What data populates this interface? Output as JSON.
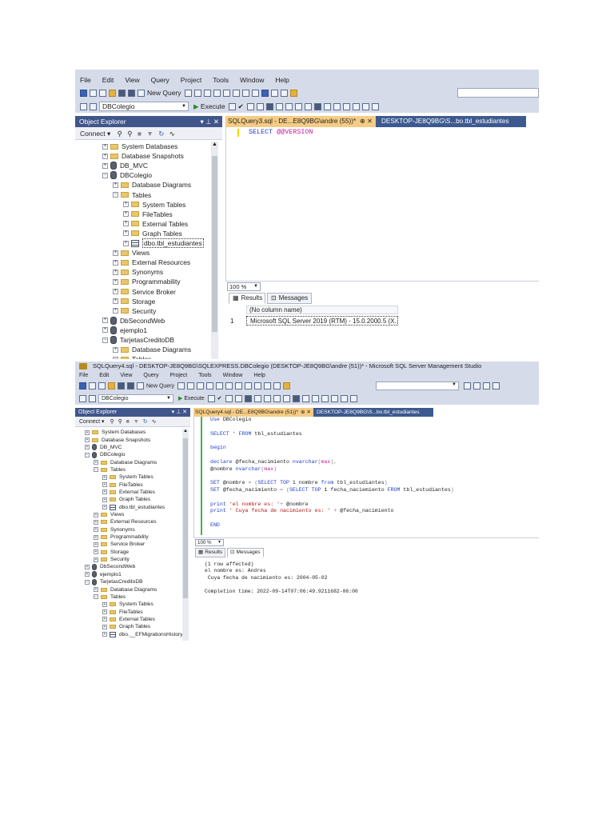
{
  "top": {
    "menu": [
      "File",
      "Edit",
      "View",
      "Query",
      "Project",
      "Tools",
      "Window",
      "Help"
    ],
    "new_query": "New Query",
    "db_selector": "DBColegio",
    "execute": "Execute",
    "explorer_title": "Object Explorer",
    "explorer_controls": "▾ ⊥ ✕",
    "connect": "Connect ▾",
    "tree": [
      {
        "label": "System Databases",
        "icon": "folder"
      },
      {
        "label": "Database Snapshots",
        "icon": "folder"
      },
      {
        "label": "DB_MVC",
        "icon": "database"
      },
      {
        "label": "DBColegio",
        "icon": "database"
      },
      {
        "label": "Database Diagrams",
        "icon": "folder"
      },
      {
        "label": "Tables",
        "icon": "folder"
      },
      {
        "label": "System Tables",
        "icon": "folder"
      },
      {
        "label": "FileTables",
        "icon": "folder"
      },
      {
        "label": "External Tables",
        "icon": "folder"
      },
      {
        "label": "Graph Tables",
        "icon": "folder"
      },
      {
        "label": "dbo.tbl_estudiantes",
        "icon": "table"
      },
      {
        "label": "Views",
        "icon": "folder"
      },
      {
        "label": "External Resources",
        "icon": "folder"
      },
      {
        "label": "Synonyms",
        "icon": "folder"
      },
      {
        "label": "Programmability",
        "icon": "folder"
      },
      {
        "label": "Service Broker",
        "icon": "folder"
      },
      {
        "label": "Storage",
        "icon": "folder"
      },
      {
        "label": "Security",
        "icon": "folder"
      },
      {
        "label": "DbSecondWeb",
        "icon": "database"
      },
      {
        "label": "ejemplo1",
        "icon": "database"
      },
      {
        "label": "TarjetasCreditoDB",
        "icon": "database"
      },
      {
        "label": "Database Diagrams",
        "icon": "folder"
      },
      {
        "label": "Tables",
        "icon": "folder"
      }
    ],
    "tab_active": "SQLQuery3.sql - DE...E8Q9BG\\andre (55))*",
    "tab_active_ctl": "⊕  ✕",
    "tab_other": "DESKTOP-JE8Q9BG\\S...bo.tbl_estudiantes",
    "code": {
      "kw": "SELECT",
      "fn": "@@VERSION"
    },
    "zoom": "100 %",
    "results_tab": "Results",
    "messages_tab": "Messages",
    "grid_header": "(No column name)",
    "grid_row_num": "1",
    "grid_value": "Microsoft SQL Server 2019 (RTM) - 15.0.2000.5 (X..."
  },
  "bottom": {
    "title": "SQLQuery4.sql - DESKTOP-JE8Q9BG\\SQLEXPRESS.DBColegio (DESKTOP-JE8Q9BG\\andre (51))* - Microsoft SQL Server Management Studio",
    "menu": [
      "File",
      "Edit",
      "View",
      "Query",
      "Project",
      "Tools",
      "Window",
      "Help"
    ],
    "new_query": "New Query",
    "db_selector": "DBColegio",
    "execute": "Execute",
    "explorer_title": "Object Explorer",
    "explorer_controls": "▾ ⊥ ✕",
    "connect": "Connect ▾",
    "tree": [
      {
        "label": "System Databases",
        "icon": "folder"
      },
      {
        "label": "Database Snapshots",
        "icon": "folder"
      },
      {
        "label": "DB_MVC",
        "icon": "database"
      },
      {
        "label": "DBColegio",
        "icon": "database"
      },
      {
        "label": "Database Diagrams",
        "icon": "folder"
      },
      {
        "label": "Tables",
        "icon": "folder"
      },
      {
        "label": "System Tables",
        "icon": "folder"
      },
      {
        "label": "FileTables",
        "icon": "folder"
      },
      {
        "label": "External Tables",
        "icon": "folder"
      },
      {
        "label": "Graph Tables",
        "icon": "folder"
      },
      {
        "label": "dbo.tbl_estudiantes",
        "icon": "table"
      },
      {
        "label": "Views",
        "icon": "folder"
      },
      {
        "label": "External Resources",
        "icon": "folder"
      },
      {
        "label": "Synonyms",
        "icon": "folder"
      },
      {
        "label": "Programmability",
        "icon": "folder"
      },
      {
        "label": "Service Broker",
        "icon": "folder"
      },
      {
        "label": "Storage",
        "icon": "folder"
      },
      {
        "label": "Security",
        "icon": "folder"
      },
      {
        "label": "DbSecondWeb",
        "icon": "database"
      },
      {
        "label": "ejemplo1",
        "icon": "database"
      },
      {
        "label": "TarjetasCreditoDB",
        "icon": "database"
      },
      {
        "label": "Database Diagrams",
        "icon": "folder"
      },
      {
        "label": "Tables",
        "icon": "folder"
      },
      {
        "label": "System Tables",
        "icon": "folder"
      },
      {
        "label": "FileTables",
        "icon": "folder"
      },
      {
        "label": "External Tables",
        "icon": "folder"
      },
      {
        "label": "Graph Tables",
        "icon": "folder"
      },
      {
        "label": "dbo.__EFMigrationsHistory",
        "icon": "table"
      }
    ],
    "tab_active": "SQLQuery4.sql - DE...E8Q9BG\\andre (51))*",
    "tab_active_ctl": "⊕  ✕",
    "tab_other": "DESKTOP-JE8Q9BG\\S...bo.tbl_estudiantes",
    "code_lines": [
      {
        "segs": [
          {
            "t": "Use",
            "c": "kw"
          },
          {
            "t": " DBColegio",
            "c": ""
          }
        ]
      },
      {
        "segs": []
      },
      {
        "segs": [
          {
            "t": "SELECT",
            "c": "kw"
          },
          {
            "t": " * ",
            "c": "gray"
          },
          {
            "t": "FROM",
            "c": "kw"
          },
          {
            "t": " tbl_estudiantes",
            "c": ""
          }
        ]
      },
      {
        "segs": []
      },
      {
        "segs": [
          {
            "t": "begin",
            "c": "kw"
          }
        ]
      },
      {
        "segs": []
      },
      {
        "segs": [
          {
            "t": "declare",
            "c": "kw"
          },
          {
            "t": " @fecha_nacimiento ",
            "c": ""
          },
          {
            "t": "nvarchar",
            "c": "kw"
          },
          {
            "t": "(",
            "c": "gray"
          },
          {
            "t": "max",
            "c": "fn"
          },
          {
            "t": "),",
            "c": "gray"
          }
        ]
      },
      {
        "segs": [
          {
            "t": "@nombre ",
            "c": ""
          },
          {
            "t": "nvarchar",
            "c": "kw"
          },
          {
            "t": "(",
            "c": "gray"
          },
          {
            "t": "max",
            "c": "fn"
          },
          {
            "t": ")",
            "c": "gray"
          }
        ]
      },
      {
        "segs": []
      },
      {
        "segs": [
          {
            "t": "SET",
            "c": "kw"
          },
          {
            "t": " @nombre ",
            "c": ""
          },
          {
            "t": "= (",
            "c": "gray"
          },
          {
            "t": "SELECT TOP",
            "c": "kw"
          },
          {
            "t": " 1 nombre ",
            "c": ""
          },
          {
            "t": "from",
            "c": "kw"
          },
          {
            "t": " tbl_estudiantes",
            "c": ""
          },
          {
            "t": ")",
            "c": "gray"
          }
        ]
      },
      {
        "segs": [
          {
            "t": "SET",
            "c": "kw"
          },
          {
            "t": " @fecha_nacimiento ",
            "c": ""
          },
          {
            "t": "= (",
            "c": "gray"
          },
          {
            "t": "SELECT TOP",
            "c": "kw"
          },
          {
            "t": " 1 fecha_naciemiento ",
            "c": ""
          },
          {
            "t": "FROM",
            "c": "kw"
          },
          {
            "t": " tbl_estudiantes",
            "c": ""
          },
          {
            "t": ")",
            "c": "gray"
          }
        ]
      },
      {
        "segs": []
      },
      {
        "segs": [
          {
            "t": "print",
            "c": "kw"
          },
          {
            "t": " 'el nombre es: '",
            "c": "str"
          },
          {
            "t": "+ ",
            "c": "gray"
          },
          {
            "t": "@nombre",
            "c": ""
          }
        ]
      },
      {
        "segs": [
          {
            "t": "print",
            "c": "kw"
          },
          {
            "t": " ' Cuya fecha de nacimiento es: '",
            "c": "str"
          },
          {
            "t": " + ",
            "c": "gray"
          },
          {
            "t": "@fecha_nacimiento",
            "c": ""
          }
        ]
      },
      {
        "segs": []
      },
      {
        "segs": [
          {
            "t": "END",
            "c": "kw"
          }
        ]
      }
    ],
    "zoom": "100 %",
    "results_tab": "Results",
    "messages_tab": "Messages",
    "messages": [
      "(1 row affected)",
      "el nombre es: Andres",
      " Cuya fecha de nacimiento es: 2004-05-02",
      "",
      "Completion time: 2022-09-14T07:06:49.9211682-06:00"
    ]
  }
}
